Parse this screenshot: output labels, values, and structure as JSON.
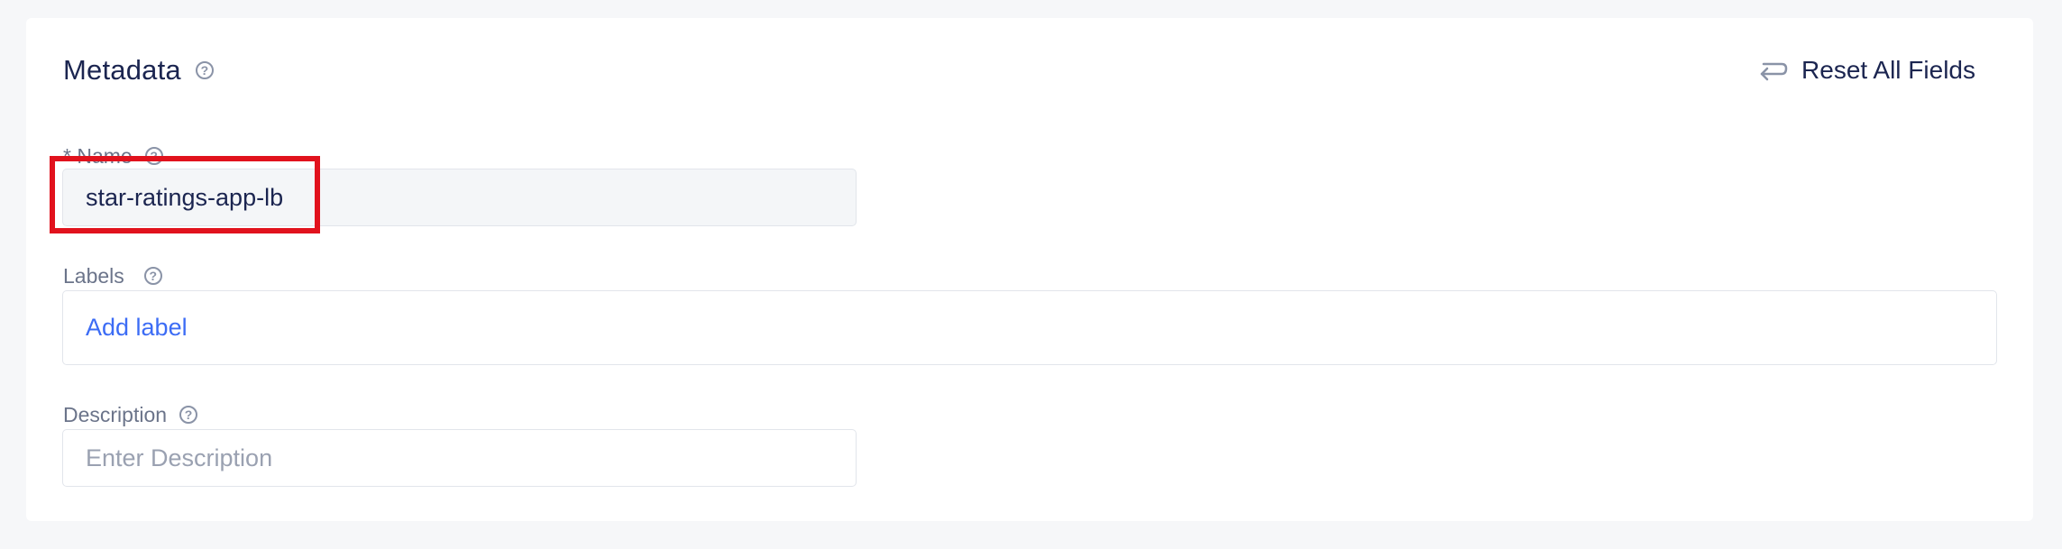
{
  "section": {
    "title": "Metadata",
    "reset_label": "Reset All Fields"
  },
  "fields": {
    "name": {
      "label": "* Name",
      "value": "star-ratings-app-lb"
    },
    "labels": {
      "label": "Labels",
      "add_label": "Add label"
    },
    "description": {
      "label": "Description",
      "placeholder": "Enter Description"
    }
  },
  "icons": {
    "help": "question-circle-icon",
    "reset": "return-arrow-icon"
  },
  "colors": {
    "title": "#1b2550",
    "link": "#3c6cf5",
    "highlight": "#e1121d"
  }
}
